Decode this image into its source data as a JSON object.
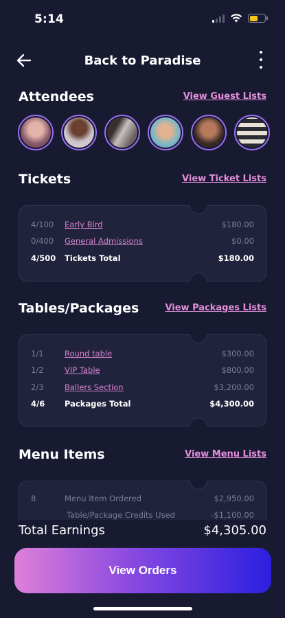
{
  "status_bar": {
    "time": "5:14"
  },
  "header": {
    "title": "Back to Paradise"
  },
  "attendees": {
    "title": "Attendees",
    "link": "View Guest Lists",
    "avatars": [
      "#c98a9a",
      "#8a5c4a",
      "#9a8a86",
      "#d3a98a",
      "#b06a52",
      "#c7b49a"
    ]
  },
  "tickets": {
    "title": "Tickets",
    "link": "View Ticket Lists",
    "rows": [
      {
        "qty": "4/100",
        "name": "Early Bird",
        "amount": "$180.00"
      },
      {
        "qty": "0/400",
        "name": "General Admissions",
        "amount": "$0.00"
      }
    ],
    "total": {
      "qty": "4/500",
      "name": "Tickets Total",
      "amount": "$180.00"
    }
  },
  "packages": {
    "title": "Tables/Packages",
    "link": "View Packages Lists",
    "rows": [
      {
        "qty": "1/1",
        "name": "Round table",
        "amount": "$300.00"
      },
      {
        "qty": "1/2",
        "name": "VIP Table",
        "amount": "$800.00"
      },
      {
        "qty": "2/3",
        "name": "Ballers Section",
        "amount": "$3,200.00"
      }
    ],
    "total": {
      "qty": "4/6",
      "name": "Packages Total",
      "amount": "$4,300.00"
    }
  },
  "menu": {
    "title": "Menu Items",
    "link": "View Menu Lists",
    "rows": [
      {
        "qty": "8",
        "name": "Menu Item Ordered",
        "amount": "$2,950.00"
      },
      {
        "qty": "",
        "name": "Table/Package Credits Used",
        "amount": "-$1,100.00"
      }
    ]
  },
  "earnings": {
    "label": "Total Earnings",
    "value": "$4,305.00"
  },
  "primary_button": {
    "label": "View Orders"
  },
  "colors": {
    "background": "#171a31",
    "card": "#20233b",
    "accent_pink": "#e48fdc",
    "accent_blue": "#2b1fe0"
  }
}
